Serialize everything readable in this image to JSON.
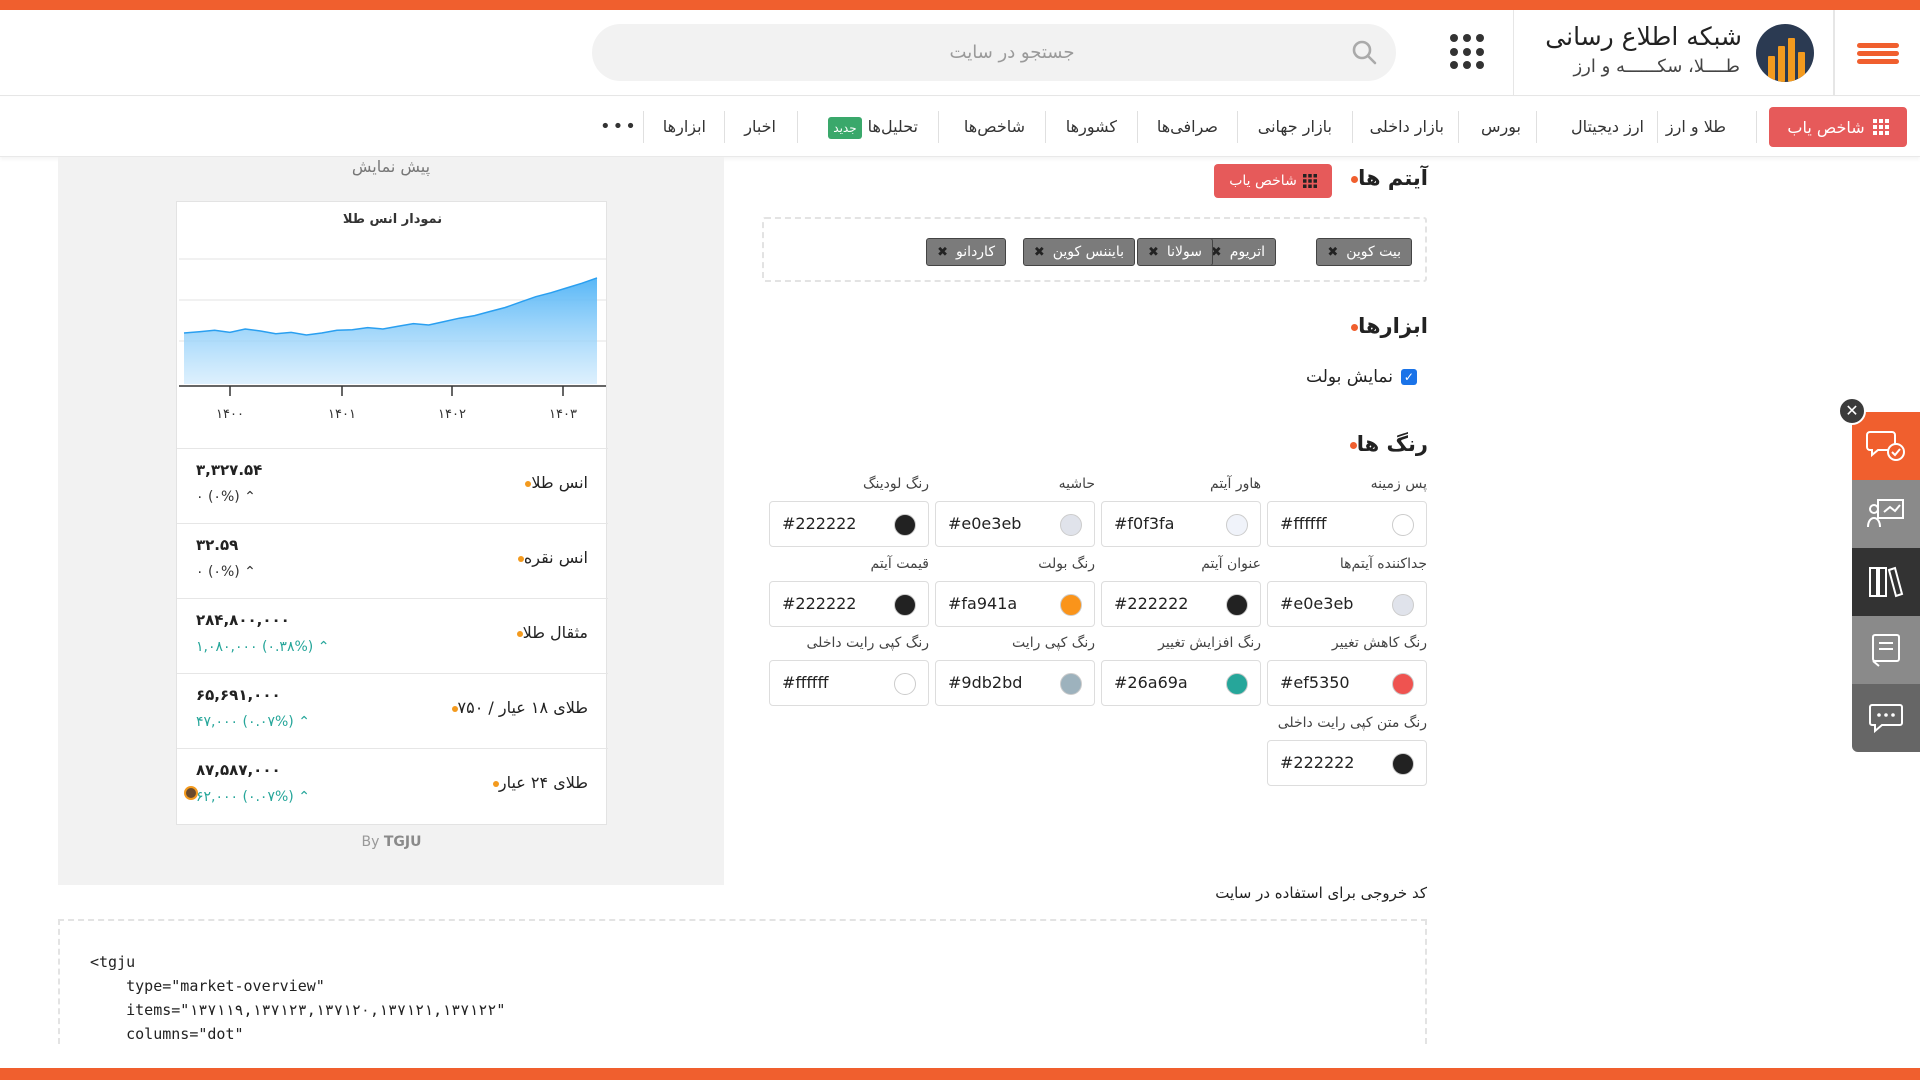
{
  "header": {
    "brand_title": "شبکه اطلاع رسانی",
    "brand_subtitle": "طــــلا، سکــــــه و ارز",
    "search_placeholder": "جستجو در سایت"
  },
  "nav": {
    "finder_label": "شاخص یاب",
    "items": [
      "طلا و ارز",
      "ارز دیجیتال",
      "بورس",
      "بازار داخلی",
      "بازار جهانی",
      "صرافی‌ها",
      "کشورها",
      "شاخص‌ها",
      "تحلیل‌ها",
      "اخبار",
      "ابزارها"
    ],
    "new_badge": "جدید",
    "more": "•••"
  },
  "preview": {
    "title": "پیش نمایش",
    "chart_title": "نمودار انس طلا",
    "byline_prefix": "By",
    "byline_brand": "TGJU",
    "rows": [
      {
        "name": "انس طلا",
        "price": "۳,۳۲۷.۵۴",
        "change": "۰  (۰%)",
        "trend": "neutral"
      },
      {
        "name": "انس نقره",
        "price": "۳۲.۵۹",
        "change": "۰  (۰%)",
        "trend": "neutral"
      },
      {
        "name": "مثقال طلا",
        "price": "۲۸۴,۸۰۰,۰۰۰",
        "change": "۱,۰۸۰,۰۰۰  (۰.۳۸%)",
        "trend": "up"
      },
      {
        "name": "طلای ۱۸ عیار / ۷۵۰",
        "price": "۶۵,۶۹۱,۰۰۰",
        "change": "۴۷,۰۰۰  (۰.۰۷%)",
        "trend": "up"
      },
      {
        "name": "طلای ۲۴ عیار",
        "price": "۸۷,۵۸۷,۰۰۰",
        "change": "۶۲,۰۰۰  (۰.۰۷%)",
        "trend": "up"
      }
    ]
  },
  "chart_data": {
    "type": "area",
    "title": "نمودار انس طلا",
    "x_ticks": [
      "۱۴۰۰",
      "۱۴۰۱",
      "۱۴۰۲",
      "۱۴۰۳"
    ],
    "series": [
      {
        "values": [
          58,
          60,
          62,
          59,
          64,
          61,
          57,
          59,
          55,
          58,
          62,
          63,
          66,
          64,
          68,
          72,
          70,
          75,
          80,
          84,
          90,
          96,
          104,
          112,
          118,
          125,
          132,
          140
        ]
      }
    ],
    "grid": true,
    "color": "#4fb3f6"
  },
  "items_section": {
    "title": "آیتم ها",
    "finder_button": "شاخص یاب",
    "tags": [
      "بیت کوین",
      "اتریوم",
      "سولانا",
      "بایننس کوین",
      "کاردانو"
    ]
  },
  "tools_section": {
    "title": "ابزارها",
    "show_bullet_label": "نمایش بولت"
  },
  "colors_section": {
    "title": "رنگ ها",
    "fields": [
      {
        "label": "پس زمینه",
        "value": "#ffffff",
        "swatch": "#ffffff"
      },
      {
        "label": "هاور آیتم",
        "value": "#f0f3fa",
        "swatch": "#f0f3fa"
      },
      {
        "label": "حاشیه",
        "value": "#e0e3eb",
        "swatch": "#e0e3eb"
      },
      {
        "label": "رنگ لودینگ",
        "value": "#222222",
        "swatch": "#222222"
      },
      {
        "label": "جداکننده آیتم‌ها",
        "value": "#e0e3eb",
        "swatch": "#e0e3eb"
      },
      {
        "label": "عنوان آیتم",
        "value": "#222222",
        "swatch": "#222222"
      },
      {
        "label": "رنگ بولت",
        "value": "#fa941a",
        "swatch": "#fa941a"
      },
      {
        "label": "قیمت آیتم",
        "value": "#222222",
        "swatch": "#222222"
      },
      {
        "label": "رنگ کاهش تغییر",
        "value": "#ef5350",
        "swatch": "#ef5350"
      },
      {
        "label": "رنگ افزایش تغییر",
        "value": "#26a69a",
        "swatch": "#26a69a"
      },
      {
        "label": "رنگ کپی رایت",
        "value": "#9db2bd",
        "swatch": "#9db2bd"
      },
      {
        "label": "رنگ کپی رایت داخلی",
        "value": "#ffffff",
        "swatch": "#ffffff"
      },
      {
        "label": "رنگ متن کپی رایت داخلی",
        "value": "#222222",
        "swatch": "#222222"
      }
    ]
  },
  "output": {
    "label": "کد خروجی برای استفاده در سایت",
    "code_lines": [
      "<tgju",
      "    type=\"market-overview\"",
      "    items=\"۱۳۷۱۱۹,۱۳۷۱۲۳,۱۳۷۱۲۰,۱۳۷۱۲۱,۱۳۷۱۲۲\"",
      "    columns=\"dot\""
    ]
  },
  "colors": {
    "accent": "#f05f2e",
    "cta": "#e65a5a",
    "up": "#26a69a",
    "bullet": "#f39a1e"
  }
}
